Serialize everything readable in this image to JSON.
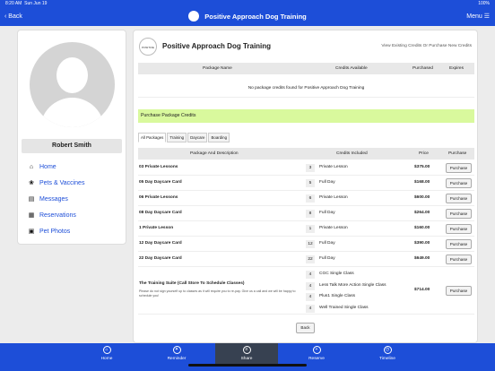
{
  "status": {
    "time": "8:20 AM",
    "date": "Sun Jun 19",
    "battery": "100%"
  },
  "nav": {
    "back": "Back",
    "title": "Positive Approach Dog Training",
    "menu": "Menu"
  },
  "sidebar": {
    "user_name": "Robert Smith",
    "items": [
      {
        "label": "Home",
        "icon": "home-icon",
        "glyph": "⌂"
      },
      {
        "label": "Pets & Vaccines",
        "icon": "paw-icon",
        "glyph": "❀"
      },
      {
        "label": "Messages",
        "icon": "message-icon",
        "glyph": "▤"
      },
      {
        "label": "Reservations",
        "icon": "calendar-icon",
        "glyph": "▦"
      },
      {
        "label": "Pet Photos",
        "icon": "photo-icon",
        "glyph": "▣"
      }
    ]
  },
  "main": {
    "logo_text": "POSITIVE APPROACH",
    "title": "Positive Approach Dog Training",
    "link": "View Existing Credits Or Purchase New Credits",
    "credits_headers": {
      "package_name": "Package Name",
      "credits_available": "Credits Available",
      "purchased": "Purchased",
      "expires": "Expires"
    },
    "empty_message": "No package credits found for Positive Approach Dog Training",
    "purchase_title": "Purchase Package Credits",
    "tabs": [
      "All Packages",
      "Training",
      "Daycare",
      "Boarding"
    ],
    "pkg_headers": {
      "package": "Package And Description",
      "credits": "Credits Included",
      "price": "Price",
      "purchase": "Purchase"
    },
    "packages": [
      {
        "name": "03 Private Lessons",
        "qty": "3",
        "desc": "Private Lesson",
        "price": "$375.00",
        "button": "Purchase"
      },
      {
        "name": "05 Day Daycare Card",
        "qty": "5",
        "desc": "Full Day",
        "price": "$168.00",
        "button": "Purchase"
      },
      {
        "name": "06 Private Lessons",
        "qty": "6",
        "desc": "Private Lesson",
        "price": "$600.00",
        "button": "Purchase"
      },
      {
        "name": "08 Day Daycare Card",
        "qty": "8",
        "desc": "Full Day",
        "price": "$264.00",
        "button": "Purchase"
      },
      {
        "name": "1 Private Lesson",
        "qty": "1",
        "desc": "Private Lesson",
        "price": "$160.00",
        "button": "Purchase"
      },
      {
        "name": "12 Day Daycare Card",
        "qty": "12",
        "desc": "Full Day",
        "price": "$390.00",
        "button": "Purchase"
      },
      {
        "name": "22 Day Daycare Card",
        "qty": "22",
        "desc": "Full Day",
        "price": "$649.00",
        "button": "Purchase"
      }
    ],
    "suite": {
      "name": "The Training Suite (Call Store To Schedule Classes)",
      "note": "Please do not sign yourself up to classes as it will require you to re-pay. Give us a call and we will be happy to schedule you!",
      "items": [
        {
          "qty": "4",
          "desc": "CGC Single Class"
        },
        {
          "qty": "4",
          "desc": "Less Talk More Action Single Class"
        },
        {
          "qty": "4",
          "desc": "Plus1 Single Class"
        },
        {
          "qty": "4",
          "desc": "Well Trained Single Class"
        }
      ],
      "price": "$714.00",
      "button": "Purchase"
    },
    "back_button": "Back"
  },
  "bottom_nav": [
    {
      "label": "Home",
      "icon": "home-icon",
      "glyph": "⌂"
    },
    {
      "label": "Reminder",
      "icon": "bell-icon",
      "glyph": "✦"
    },
    {
      "label": "Share",
      "icon": "share-icon",
      "glyph": "≡"
    },
    {
      "label": "Reserve",
      "icon": "plus-icon",
      "glyph": "+"
    },
    {
      "label": "Timeline",
      "icon": "clock-icon",
      "glyph": "◷"
    }
  ],
  "colors": {
    "primary": "#1d4ed8",
    "purchase_bar": "#d9f99d",
    "active_tab": "#374151"
  }
}
